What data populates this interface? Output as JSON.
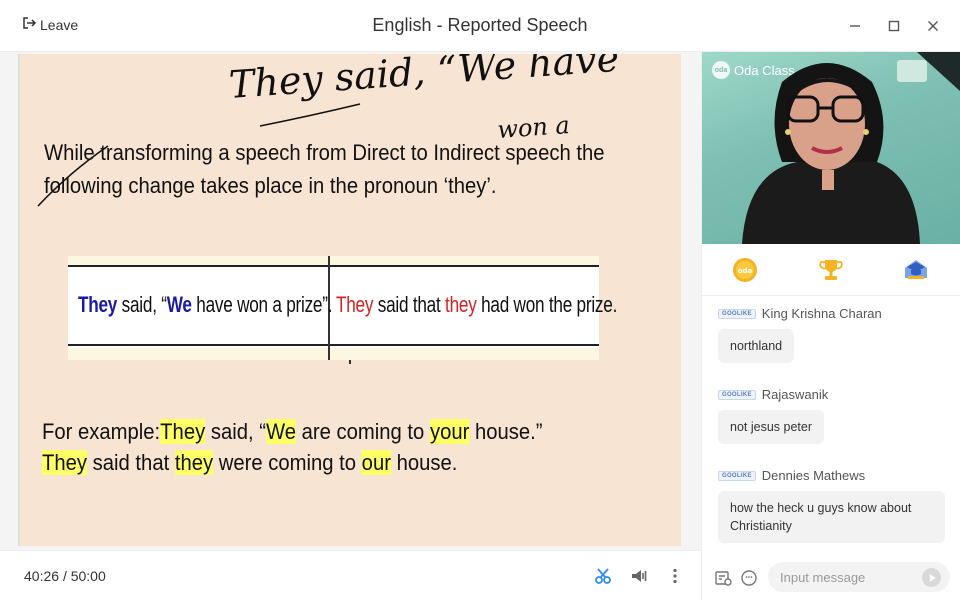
{
  "header": {
    "leave_label": "Leave",
    "title": "English - Reported Speech"
  },
  "slide": {
    "line1": "While transforming a speech from Direct to Indirect speech the",
    "line2": "following change takes place in the pronoun ‘they’.",
    "table": {
      "left": [
        "They",
        " said, “",
        "We",
        " have won a prize”."
      ],
      "right": [
        "They",
        " said that ",
        "they",
        " had won the prize."
      ]
    },
    "example1": [
      "For example:",
      "They",
      " said, “",
      "We",
      " are coming to ",
      "your",
      " house.”"
    ],
    "example2": [
      "They",
      " said that ",
      "they",
      " were coming to ",
      "our",
      " house."
    ]
  },
  "annotation": {
    "line1": "They said, “We have",
    "line2": "won a"
  },
  "footer": {
    "elapsed": "40:26",
    "separator": "/",
    "total": "50:00"
  },
  "video": {
    "brand": "Oda Class",
    "brand_logo_text": "oda"
  },
  "rewards": [
    "coin-icon",
    "trophy-icon",
    "graduation-cap-icon"
  ],
  "reward_coin_text": "oda",
  "chat": {
    "badge": "GOOLIKE",
    "messages": [
      {
        "name": "King Krishna Charan",
        "text": "northland"
      },
      {
        "name": "Rajaswanik",
        "text": "not jesus peter"
      },
      {
        "name": "Dennies Mathews",
        "text": "how the heck u guys know about Christianity"
      }
    ],
    "input_placeholder": "Input message"
  },
  "colors": {
    "slide_bg": "#f8e4d3",
    "highlight": "#ffff66",
    "pronoun_blue": "#1a1aa6",
    "pronoun_red": "#d82020",
    "accent": "#2d8cf0"
  }
}
